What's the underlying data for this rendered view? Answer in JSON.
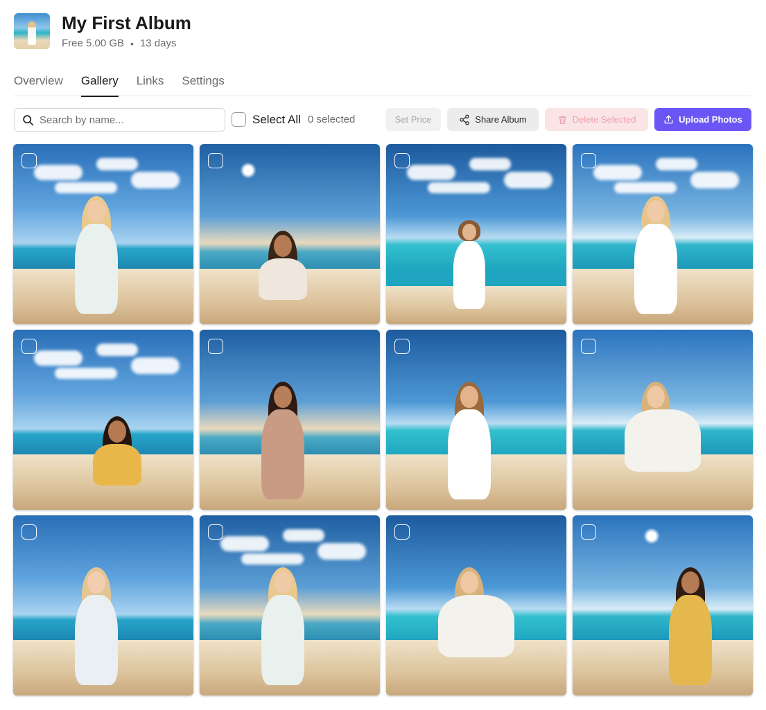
{
  "album": {
    "title": "My First Album",
    "storage": "Free 5.00 GB",
    "separator": "•",
    "duration": "13 days"
  },
  "tabs": [
    {
      "label": "Overview",
      "active": false
    },
    {
      "label": "Gallery",
      "active": true
    },
    {
      "label": "Links",
      "active": false
    },
    {
      "label": "Settings",
      "active": false
    }
  ],
  "toolbar": {
    "search_placeholder": "Search by name...",
    "select_all_label": "Select All",
    "selected_count": "0 selected",
    "set_price_label": "Set Price",
    "share_label": "Share Album",
    "delete_label": "Delete Selected",
    "upload_label": "Upload Photos"
  },
  "colors": {
    "accent": "#6b56f5",
    "danger_bg": "#fbe4e6",
    "danger_text": "#f0a0aa"
  },
  "photos": [
    {
      "name": "beach-photo-1",
      "hair": "#e9c98d",
      "dress": "#e8f1ee",
      "skin": "#f0c9a6",
      "pose": "standing",
      "clouds": true
    },
    {
      "name": "beach-photo-2",
      "hair": "#3a2418",
      "dress": "#efe7dd",
      "skin": "#b47b55",
      "pose": "sitting",
      "sun": true
    },
    {
      "name": "beach-photo-3",
      "hair": "#8a5a35",
      "dress": "#ffffff",
      "skin": "#e0b58f",
      "pose": "standing-far",
      "clouds": true
    },
    {
      "name": "beach-photo-4",
      "hair": "#e6c48a",
      "dress": "#ffffff",
      "skin": "#f0c9a6",
      "pose": "standing-hat",
      "clouds": true
    },
    {
      "name": "beach-photo-5",
      "hair": "#24160f",
      "dress": "#e9b64a",
      "skin": "#b57a52",
      "pose": "sitting",
      "clouds": true
    },
    {
      "name": "beach-photo-6",
      "hair": "#2d1a12",
      "dress": "#c99a84",
      "skin": "#b8805a",
      "pose": "standing"
    },
    {
      "name": "beach-photo-7",
      "hair": "#9a6a3c",
      "dress": "#ffffff",
      "skin": "#e3b48c",
      "pose": "standing"
    },
    {
      "name": "beach-photo-8",
      "hair": "#d8b27c",
      "dress": "#f4f2ec",
      "skin": "#eec7a3",
      "pose": "kneeling"
    },
    {
      "name": "beach-photo-9",
      "hair": "#e3c694",
      "dress": "#e9eff3",
      "skin": "#f2cdb0",
      "pose": "standing"
    },
    {
      "name": "beach-photo-10",
      "hair": "#e9c98d",
      "dress": "#e8f1ee",
      "skin": "#f0c9a6",
      "pose": "standing",
      "clouds": true
    },
    {
      "name": "beach-photo-11",
      "hair": "#d8b27c",
      "dress": "#f4f2ec",
      "skin": "#eec7a3",
      "pose": "kneeling"
    },
    {
      "name": "beach-photo-12",
      "hair": "#2f1c12",
      "dress": "#e4b84c",
      "skin": "#b47b55",
      "pose": "standing",
      "sun": true
    }
  ]
}
